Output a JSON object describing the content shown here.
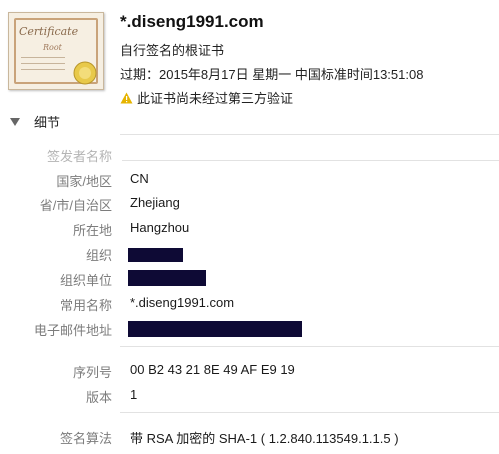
{
  "certificate": {
    "icon_title": "Certificate",
    "icon_subtitle": "Root",
    "common_name_title": "*.diseng1991.com",
    "type": "自行签名的根证书",
    "expiry": "过期：2015年8月17日 星期一 中国标准时间13:51:08",
    "warning": "此证书尚未经过第三方验证"
  },
  "details": {
    "toggle_label": "细节",
    "issuer_section": "签发者名称",
    "fields": [
      {
        "label": "国家/地区",
        "value": "CN"
      },
      {
        "label": "省/市/自治区",
        "value": "Zhejiang"
      },
      {
        "label": "所在地",
        "value": "Hangzhou"
      },
      {
        "label": "组织",
        "value": ""
      },
      {
        "label": "组织单位",
        "value": ""
      },
      {
        "label": "常用名称",
        "value": "*.diseng1991.com"
      },
      {
        "label": "电子邮件地址",
        "value": ""
      }
    ],
    "serial_label": "序列号",
    "serial_value": "00 B2 43 21 8E 49 AF E9 19",
    "version_label": "版本",
    "version_value": "1",
    "sig_label": "签名算法",
    "sig_value": "带 RSA 加密的 SHA-1 ( 1.2.840.113549.1.1.5 )"
  },
  "colors": {
    "redaction": "#0e0a35",
    "label": "#7c7c7c",
    "warning": "#e6b400"
  }
}
